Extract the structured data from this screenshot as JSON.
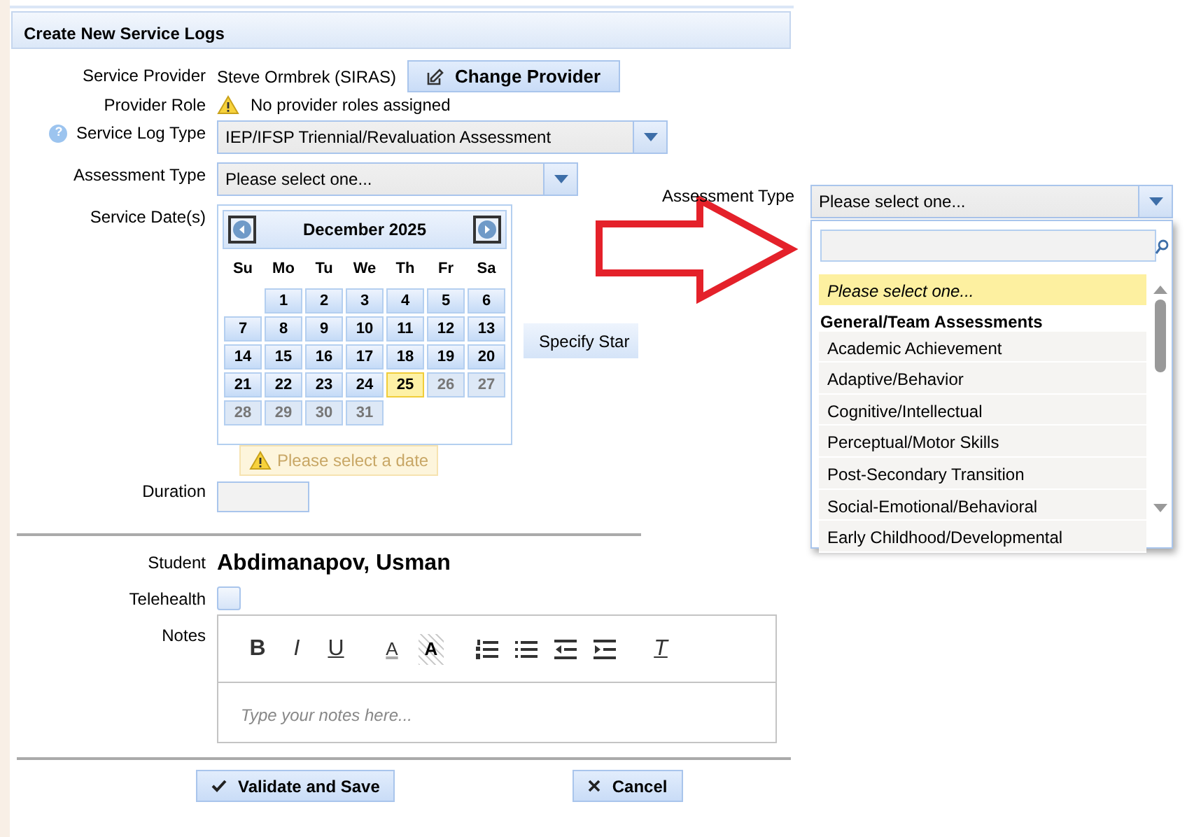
{
  "panel_title": "Create New Service Logs",
  "service_provider": {
    "label": "Service Provider",
    "value": "Steve Ormbrek (SIRAS)",
    "button": "Change Provider"
  },
  "provider_role": {
    "label": "Provider Role",
    "warning": "No provider roles assigned"
  },
  "service_log_type": {
    "label": "Service Log Type",
    "help": "?",
    "value": "IEP/IFSP Triennial/Revaluation Assessment"
  },
  "assessment_type": {
    "label": "Assessment Type",
    "value": "Please select one..."
  },
  "service_dates": {
    "label": "Service Date(s)",
    "specify_button": "Specify Star",
    "calendar": {
      "title": "December 2025",
      "weekdays": [
        "Su",
        "Mo",
        "Tu",
        "We",
        "Th",
        "Fr",
        "Sa"
      ],
      "weeks": [
        [
          {
            "label": "1",
            "today": false,
            "disabled": false
          },
          {
            "label": "2",
            "today": false,
            "disabled": false
          },
          {
            "label": "3",
            "today": false,
            "disabled": false
          },
          {
            "label": "4",
            "today": false,
            "disabled": false
          },
          {
            "label": "5",
            "today": false,
            "disabled": false
          },
          {
            "label": "6",
            "today": false,
            "disabled": false
          }
        ],
        [
          {
            "label": "7",
            "today": false,
            "disabled": false
          },
          {
            "label": "8",
            "today": false,
            "disabled": false
          },
          {
            "label": "9",
            "today": false,
            "disabled": false
          },
          {
            "label": "10",
            "today": false,
            "disabled": false
          },
          {
            "label": "11",
            "today": false,
            "disabled": false
          },
          {
            "label": "12",
            "today": false,
            "disabled": false
          },
          {
            "label": "13",
            "today": false,
            "disabled": false
          }
        ],
        [
          {
            "label": "14",
            "today": false,
            "disabled": false
          },
          {
            "label": "15",
            "today": false,
            "disabled": false
          },
          {
            "label": "16",
            "today": false,
            "disabled": false
          },
          {
            "label": "17",
            "today": false,
            "disabled": false
          },
          {
            "label": "18",
            "today": false,
            "disabled": false
          },
          {
            "label": "19",
            "today": false,
            "disabled": false
          },
          {
            "label": "20",
            "today": false,
            "disabled": false
          }
        ],
        [
          {
            "label": "21",
            "today": false,
            "disabled": false
          },
          {
            "label": "22",
            "today": false,
            "disabled": false
          },
          {
            "label": "23",
            "today": false,
            "disabled": false
          },
          {
            "label": "24",
            "today": false,
            "disabled": false
          },
          {
            "label": "25",
            "today": true,
            "disabled": false
          },
          {
            "label": "26",
            "today": false,
            "disabled": true
          },
          {
            "label": "27",
            "today": false,
            "disabled": true
          }
        ],
        [
          {
            "label": "28",
            "today": false,
            "disabled": true
          },
          {
            "label": "29",
            "today": false,
            "disabled": true
          },
          {
            "label": "30",
            "today": false,
            "disabled": true
          },
          {
            "label": "31",
            "today": false,
            "disabled": true
          }
        ]
      ]
    },
    "warning": "Please select a date"
  },
  "duration": {
    "label": "Duration"
  },
  "student": {
    "label": "Student",
    "value": "Abdimanapov, Usman"
  },
  "telehealth": {
    "label": "Telehealth",
    "checked": false
  },
  "notes": {
    "label": "Notes",
    "placeholder": "Type your notes here...",
    "toolbar": [
      {
        "kind": "bold",
        "label": "B"
      },
      {
        "kind": "italic",
        "label": "I"
      },
      {
        "kind": "underline",
        "label": "U"
      },
      {
        "kind": "font-color",
        "label": "A"
      },
      {
        "kind": "background-color",
        "label": "A"
      },
      {
        "kind": "numbered-list"
      },
      {
        "kind": "bullet-list"
      },
      {
        "kind": "outdent"
      },
      {
        "kind": "indent"
      },
      {
        "kind": "clear-format",
        "label": "T"
      }
    ]
  },
  "buttons": [
    {
      "kind": "save",
      "label": "Validate and Save"
    },
    {
      "kind": "cancel",
      "label": "Cancel"
    }
  ],
  "assessment_dropdown": {
    "label": "Assessment Type",
    "value": "Please select one...",
    "options": [
      {
        "kind": "option",
        "label": "Please select one...",
        "selected": true
      },
      {
        "kind": "group",
        "label": "General/Team Assessments"
      },
      {
        "kind": "option",
        "label": "Academic Achievement",
        "selected": false
      },
      {
        "kind": "option",
        "label": "Adaptive/Behavior",
        "selected": false
      },
      {
        "kind": "option",
        "label": "Cognitive/Intellectual",
        "selected": false
      },
      {
        "kind": "option",
        "label": "Perceptual/Motor Skills",
        "selected": false
      },
      {
        "kind": "option",
        "label": "Post-Secondary Transition",
        "selected": false
      },
      {
        "kind": "option",
        "label": "Social-Emotional/Behavioral",
        "selected": false
      },
      {
        "kind": "option",
        "label": "Early Childhood/Developmental",
        "selected": false
      }
    ]
  }
}
